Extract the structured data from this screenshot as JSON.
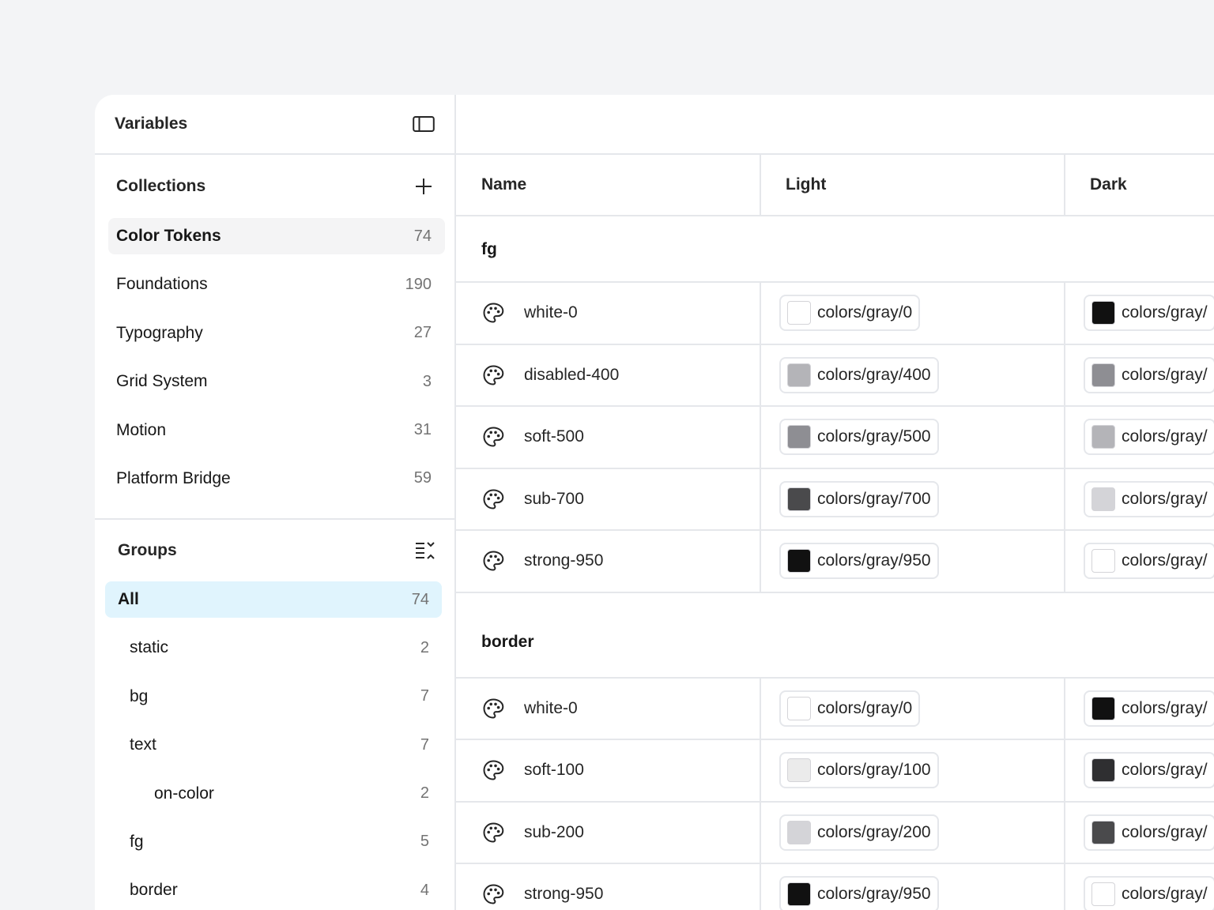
{
  "sidebar": {
    "title": "Variables",
    "collections_title": "Collections",
    "collections": [
      {
        "label": "Color Tokens",
        "count": "74",
        "active": true
      },
      {
        "label": "Foundations",
        "count": "190"
      },
      {
        "label": "Typography",
        "count": "27"
      },
      {
        "label": "Grid System",
        "count": "3"
      },
      {
        "label": "Motion",
        "count": "31"
      },
      {
        "label": "Platform Bridge",
        "count": "59"
      }
    ],
    "groups_title": "Groups",
    "groups": [
      {
        "label": "All",
        "count": "74",
        "level": 0,
        "active": true
      },
      {
        "label": "static",
        "count": "2",
        "level": 1
      },
      {
        "label": "bg",
        "count": "7",
        "level": 1
      },
      {
        "label": "text",
        "count": "7",
        "level": 1
      },
      {
        "label": "on-color",
        "count": "2",
        "level": 2
      },
      {
        "label": "fg",
        "count": "5",
        "level": 1
      },
      {
        "label": "border",
        "count": "4",
        "level": 1
      }
    ]
  },
  "table": {
    "columns": [
      "Name",
      "Light",
      "Dark"
    ],
    "sections": [
      {
        "title": "fg",
        "rows": [
          {
            "name": "white-0",
            "light": "colors/gray/0",
            "light_color": "#ffffff",
            "dark": "colors/gray/",
            "dark_color": "#111111"
          },
          {
            "name": "disabled-400",
            "light": "colors/gray/400",
            "light_color": "#b4b4b8",
            "dark": "colors/gray/",
            "dark_color": "#8e8e93"
          },
          {
            "name": "soft-500",
            "light": "colors/gray/500",
            "light_color": "#8e8e93",
            "dark": "colors/gray/",
            "dark_color": "#b4b4b8"
          },
          {
            "name": "sub-700",
            "light": "colors/gray/700",
            "light_color": "#4a4a4c",
            "dark": "colors/gray/",
            "dark_color": "#d4d4d8"
          },
          {
            "name": "strong-950",
            "light": "colors/gray/950",
            "light_color": "#111111",
            "dark": "colors/gray/",
            "dark_color": "#ffffff"
          }
        ]
      },
      {
        "title": "border",
        "rows": [
          {
            "name": "white-0",
            "light": "colors/gray/0",
            "light_color": "#ffffff",
            "dark": "colors/gray/",
            "dark_color": "#111111"
          },
          {
            "name": "soft-100",
            "light": "colors/gray/100",
            "light_color": "#ebebeb",
            "dark": "colors/gray/",
            "dark_color": "#2f2f31"
          },
          {
            "name": "sub-200",
            "light": "colors/gray/200",
            "light_color": "#d4d4d8",
            "dark": "colors/gray/",
            "dark_color": "#4a4a4c"
          },
          {
            "name": "strong-950",
            "light": "colors/gray/950",
            "light_color": "#111111",
            "dark": "colors/gray/",
            "dark_color": "#ffffff"
          }
        ]
      }
    ]
  },
  "icons": {
    "sidebar_toggle": "sidebar-panel-icon",
    "add": "plus-icon",
    "collapse": "collapse-list-icon",
    "variable": "palette-icon"
  }
}
